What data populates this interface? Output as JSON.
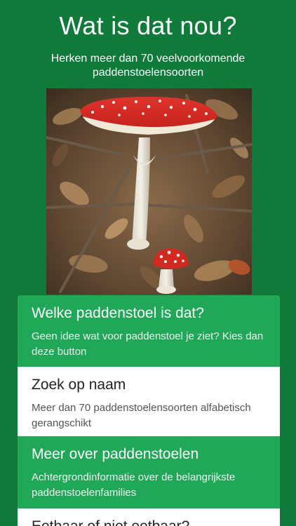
{
  "header": {
    "title": "Wat is dat nou?",
    "subtitle": "Herken meer dan 70 veelvoorkomende paddenstoelensoorten"
  },
  "photo": {
    "icon": "fly-agaric-mushroom-photo"
  },
  "menu": {
    "items": [
      {
        "title": "Welke paddenstoel is dat?",
        "description": "Geen idee wat voor paddenstoel je ziet? Kies dan deze button"
      },
      {
        "title": "Zoek op naam",
        "description": "Meer dan 70 paddenstoelensoorten alfabetisch gerangschikt"
      },
      {
        "title": "Meer over paddenstoelen",
        "description": "Achtergrondinformatie over de belangrijkste paddenstoelenfamilies"
      },
      {
        "title": "Eetbaar of niet eetbaar?",
        "description": ""
      }
    ]
  },
  "colors": {
    "background": "#0f7a3a",
    "card_green": "#21a758",
    "card_white": "#ffffff"
  }
}
